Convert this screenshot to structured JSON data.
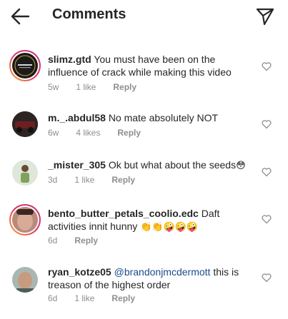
{
  "header": {
    "title": "Comments",
    "back_icon": "arrow-left-icon",
    "send_icon": "paper-plane-icon"
  },
  "comments": [
    {
      "username": "slimz.gtd",
      "text": "You must have been on the influence of crack while making this video",
      "time": "5w",
      "likes": "1 like",
      "reply": "Reply"
    },
    {
      "username": "m._.abdul58",
      "text": "No mate absolutely NOT",
      "time": "6w",
      "likes": "4 likes",
      "reply": "Reply"
    },
    {
      "username": "_mister_305",
      "text": "Ok but what about the seeds",
      "emoji": "😳",
      "time": "3d",
      "likes": "1 like",
      "reply": "Reply"
    },
    {
      "username": "bento_butter_petals_coolio.edc",
      "text": "Daft activities innit hunny",
      "emoji": "👏👏🤪🤪🤪",
      "time": "6d",
      "reply": "Reply"
    },
    {
      "username": "ryan_kotze05",
      "mention": "@brandonjmcdermott",
      "text": "this is treason of the highest order",
      "time": "6d",
      "likes": "1 like",
      "reply": "Reply"
    }
  ],
  "colors": {
    "text": "#262626",
    "meta": "#8e8e8e",
    "mention": "#1a4b8c"
  }
}
